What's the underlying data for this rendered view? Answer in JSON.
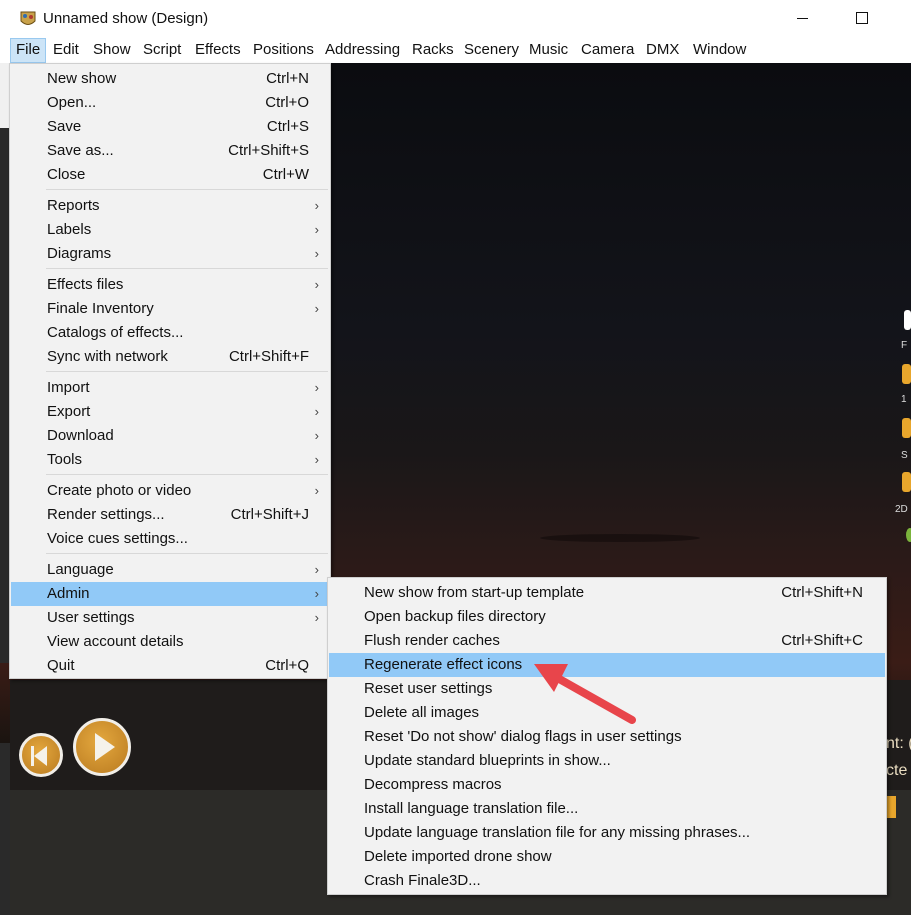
{
  "window": {
    "title": "Unnamed show (Design)"
  },
  "menubar": {
    "items": [
      "File",
      "Edit",
      "Show",
      "Script",
      "Effects",
      "Positions",
      "Addressing",
      "Racks",
      "Scenery",
      "Music",
      "Camera",
      "DMX",
      "Window"
    ]
  },
  "file_menu": {
    "items": [
      {
        "label": "New show",
        "shortcut": "Ctrl+N"
      },
      {
        "label": "Open...",
        "shortcut": "Ctrl+O"
      },
      {
        "label": "Save",
        "shortcut": "Ctrl+S"
      },
      {
        "label": "Save as...",
        "shortcut": "Ctrl+Shift+S"
      },
      {
        "label": "Close",
        "shortcut": "Ctrl+W"
      },
      {
        "label": "Reports",
        "shortcut": ""
      },
      {
        "label": "Labels",
        "shortcut": ""
      },
      {
        "label": "Diagrams",
        "shortcut": ""
      },
      {
        "label": "Effects files",
        "shortcut": ""
      },
      {
        "label": "Finale Inventory",
        "shortcut": ""
      },
      {
        "label": "Catalogs of effects...",
        "shortcut": ""
      },
      {
        "label": "Sync with network",
        "shortcut": "Ctrl+Shift+F"
      },
      {
        "label": "Import",
        "shortcut": ""
      },
      {
        "label": "Export",
        "shortcut": ""
      },
      {
        "label": "Download",
        "shortcut": ""
      },
      {
        "label": "Tools",
        "shortcut": ""
      },
      {
        "label": "Create photo or video",
        "shortcut": ""
      },
      {
        "label": "Render settings...",
        "shortcut": "Ctrl+Shift+J"
      },
      {
        "label": "Voice cues settings...",
        "shortcut": ""
      },
      {
        "label": "Language",
        "shortcut": ""
      },
      {
        "label": "Admin",
        "shortcut": ""
      },
      {
        "label": "User settings",
        "shortcut": ""
      },
      {
        "label": "View account details",
        "shortcut": ""
      },
      {
        "label": "Quit",
        "shortcut": "Ctrl+Q"
      }
    ],
    "highlighted": "Admin"
  },
  "admin_menu": {
    "items": [
      {
        "label": "New show from start-up template",
        "shortcut": "Ctrl+Shift+N"
      },
      {
        "label": "Open backup files directory",
        "shortcut": ""
      },
      {
        "label": "Flush render caches",
        "shortcut": "Ctrl+Shift+C"
      },
      {
        "label": "Regenerate effect icons",
        "shortcut": ""
      },
      {
        "label": "Reset user settings",
        "shortcut": ""
      },
      {
        "label": "Delete all images",
        "shortcut": ""
      },
      {
        "label": "Reset 'Do not show' dialog flags in user settings",
        "shortcut": ""
      },
      {
        "label": "Update standard blueprints in show...",
        "shortcut": ""
      },
      {
        "label": "Decompress macros",
        "shortcut": ""
      },
      {
        "label": "Install language translation file...",
        "shortcut": ""
      },
      {
        "label": "Update language translation file for any missing phrases...",
        "shortcut": ""
      },
      {
        "label": "Delete imported drone show",
        "shortcut": ""
      },
      {
        "label": "Crash Finale3D...",
        "shortcut": ""
      }
    ],
    "highlighted": "Regenerate effect icons"
  },
  "scene": {
    "side_labels": [
      "F",
      "1",
      "S",
      "2D"
    ],
    "right_text_1": "nt: (",
    "right_text_2": "cte"
  },
  "colors": {
    "highlight": "#91c9f7",
    "menu_bg": "#f2f2f2",
    "accent_gold": "#e8a62c",
    "annotation_red": "#e8454b"
  },
  "icons": [
    "app-icon",
    "minimize-icon",
    "maximize-icon",
    "submenu-arrow-icon",
    "previous-icon",
    "play-icon",
    "speaker-icon",
    "annotation-arrow"
  ]
}
